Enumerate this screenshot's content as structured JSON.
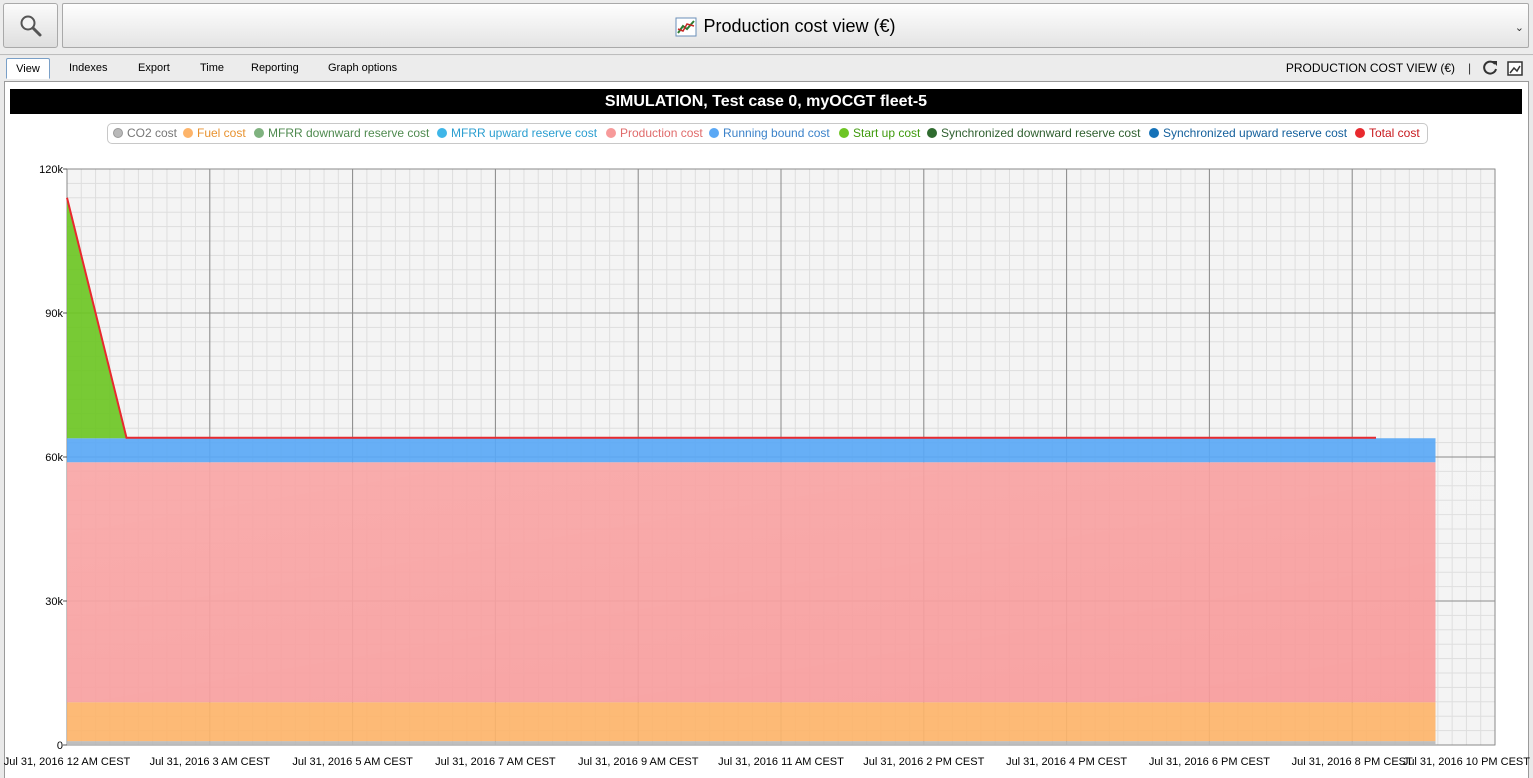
{
  "header": {
    "title": "Production cost view (€)",
    "search_icon": "magnifier-icon",
    "title_icon": "line-chart-icon"
  },
  "tabs": [
    {
      "label": "View",
      "active": true
    },
    {
      "label": "Indexes"
    },
    {
      "label": "Export"
    },
    {
      "label": "Time"
    },
    {
      "label": "Reporting"
    },
    {
      "label": "Graph options"
    }
  ],
  "toolbar": {
    "view_caption": "PRODUCTION COST VIEW (€)",
    "separator": "|",
    "refresh_icon": "refresh-icon",
    "image_export_icon": "export-image-icon"
  },
  "chart_data": {
    "type": "area",
    "title": "SIMULATION, Test case 0, myOCGT fleet-5",
    "legend_position": "top",
    "grid": true,
    "y_ticks": [
      "0",
      "30k",
      "60k",
      "90k",
      "120k"
    ],
    "ylim": [
      0,
      120000
    ],
    "x_ticks": [
      "Jul 31, 2016 12 AM CEST",
      "Jul 31, 2016 3 AM CEST",
      "Jul 31, 2016 5 AM CEST",
      "Jul 31, 2016 7 AM CEST",
      "Jul 31, 2016 9 AM CEST",
      "Jul 31, 2016 11 AM CEST",
      "Jul 31, 2016 2 PM CEST",
      "Jul 31, 2016 4 PM CEST",
      "Jul 31, 2016 6 PM CEST",
      "Jul 31, 2016 8 PM CEST",
      "Jul 31, 2016 10 PM CEST"
    ],
    "x": [
      0,
      1,
      23
    ],
    "stacked": true,
    "series": [
      {
        "name": "CO2 cost",
        "color": "#b9b9b9",
        "values": [
          800,
          800,
          800
        ]
      },
      {
        "name": "Fuel cost",
        "color": "#fdb46a",
        "values": [
          8100,
          8100,
          8100
        ]
      },
      {
        "name": "MFRR downward reserve cost",
        "color": "#7fb27f",
        "values": [
          0,
          0,
          0
        ]
      },
      {
        "name": "MFRR upward reserve cost",
        "color": "#3fb6e8",
        "values": [
          0,
          0,
          0
        ]
      },
      {
        "name": "Production cost",
        "color": "#f79a9a",
        "values": [
          50000,
          50000,
          50000
        ]
      },
      {
        "name": "Running bound cost",
        "color": "#5aa8f5",
        "values": [
          5000,
          5000,
          5000
        ]
      },
      {
        "name": "Start up cost",
        "color": "#6dc524",
        "values": [
          50000,
          0,
          0
        ]
      },
      {
        "name": "Synchronized downward reserve cost",
        "color": "#2f6b2f",
        "values": [
          0,
          0,
          0
        ]
      },
      {
        "name": "Synchronized upward reserve cost",
        "color": "#1572b8",
        "values": [
          0,
          0,
          0
        ]
      }
    ],
    "line": {
      "name": "Total cost",
      "color": "#e8292e",
      "x": [
        0,
        1,
        22
      ],
      "values": [
        114000,
        64000,
        64000
      ]
    }
  }
}
